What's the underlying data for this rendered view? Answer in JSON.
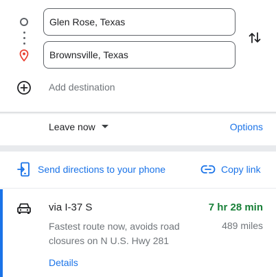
{
  "directions": {
    "origin": "Glen Rose, Texas",
    "destination": "Brownsville, Texas",
    "add_destination": "Add destination"
  },
  "options_bar": {
    "leave_now": "Leave now",
    "options": "Options"
  },
  "share": {
    "send_to_phone": "Send directions to your phone",
    "copy_link": "Copy link"
  },
  "route": {
    "via": "via I-37 S",
    "duration": "7 hr 28 min",
    "description": "Fastest route now, avoids road closures on N U.S. Hwy 281",
    "distance": "489 miles",
    "details": "Details"
  },
  "colors": {
    "accent": "#1a73e8",
    "duration_green": "#188038",
    "pin_red": "#ea4335",
    "secondary_text": "#70757a"
  },
  "icons": [
    "origin-circle-icon",
    "route-dots-icon",
    "destination-pin-icon",
    "swap-icon",
    "add-icon",
    "phone-icon",
    "link-icon",
    "car-icon",
    "dropdown-caret-icon"
  ]
}
